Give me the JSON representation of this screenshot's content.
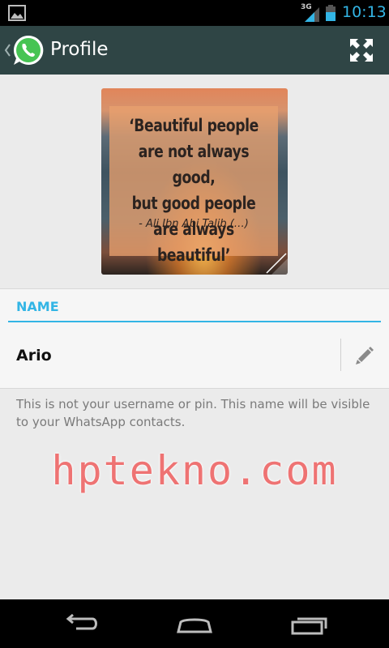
{
  "status_bar": {
    "network_type": "3G",
    "time": "10:13",
    "icons": [
      "gallery-notification-icon",
      "signal-icon",
      "battery-icon"
    ]
  },
  "action_bar": {
    "title": "Profile",
    "icons": [
      "up-arrow-icon",
      "whatsapp-logo-icon",
      "fullscreen-icon"
    ],
    "background_color": "#2f4545"
  },
  "profile_photo": {
    "quote_lines": [
      "‘Beautiful people",
      "are not always good,",
      "but good people",
      "are always beautiful’"
    ],
    "author": "- Ali Ibn Abi Talib (…)"
  },
  "name_section": {
    "header": "NAME",
    "value": "Ario",
    "edit_icon": "pencil-icon",
    "accent_color": "#33b5e5"
  },
  "hint": "This is not your username or pin. This name will be visible to your WhatsApp contacts.",
  "watermark": "hptekno.com",
  "nav_bar": {
    "buttons": [
      "back-icon",
      "home-icon",
      "recent-apps-icon"
    ]
  }
}
